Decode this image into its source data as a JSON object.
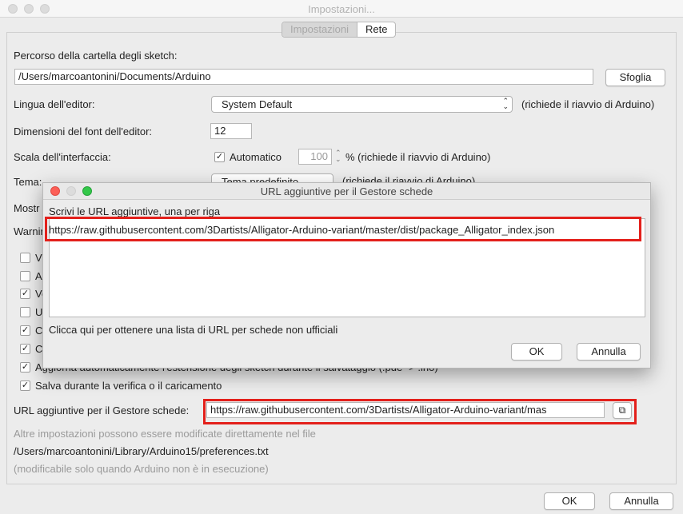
{
  "window": {
    "title": "Impostazioni..."
  },
  "tabs": [
    {
      "label": "Impostazioni"
    },
    {
      "label": "Rete"
    }
  ],
  "settings": {
    "sketchbook_label": "Percorso della cartella degli sketch:",
    "sketchbook_value": "/Users/marcoantonini/Documents/Arduino",
    "browse_label": "Sfoglia",
    "language_label": "Lingua dell'editor:",
    "language_value": "System Default",
    "language_note": "(richiede il riavvio di Arduino)",
    "font_label": "Dimensioni del font dell'editor:",
    "font_value": "12",
    "scale_label": "Scala dell'interfaccia:",
    "scale_auto_label": "Automatico",
    "scale_value": "100",
    "scale_note": "% (richiede il riavvio di Arduino)",
    "theme_label": "Tema:",
    "theme_value": "Tema predefinito",
    "theme_note": "(richiede il riavvio di Arduino)",
    "show_label": "Mostr",
    "warnings_label": "Warnin",
    "check_partials": [
      "Vi",
      "A",
      "Ve",
      "U",
      "C",
      "C"
    ],
    "autoformat_label": "Aggiorna automaticamente l'estensione degli sketch durante il salvataggio (.pde -> .ino)",
    "save_verify_label": "Salva durante la verifica o il caricamento",
    "boards_url_label": "URL aggiuntive per il Gestore schede:",
    "boards_url_value": "https://raw.githubusercontent.com/3Dartists/Alligator-Arduino-variant/mas",
    "more_prefs": "Altre impostazioni possono essere modificate direttamente nel file",
    "prefs_path": "/Users/marcoantonini/Library/Arduino15/preferences.txt",
    "prefs_note": "(modificabile solo quando Arduino non è in esecuzione)"
  },
  "dialog": {
    "title": "URL aggiuntive per il Gestore schede",
    "instruction": "Scrivi le URL aggiuntive, una per riga",
    "url_line": "https://raw.githubusercontent.com/3Dartists/Alligator-Arduino-variant/master/dist/package_Alligator_index.json",
    "link_text": "Clicca qui per ottenere una lista di URL per schede non ufficiali",
    "ok_label": "OK",
    "cancel_label": "Annulla"
  },
  "footer": {
    "ok_label": "OK",
    "cancel_label": "Annulla"
  },
  "colors": {
    "highlight": "#e3201b"
  }
}
